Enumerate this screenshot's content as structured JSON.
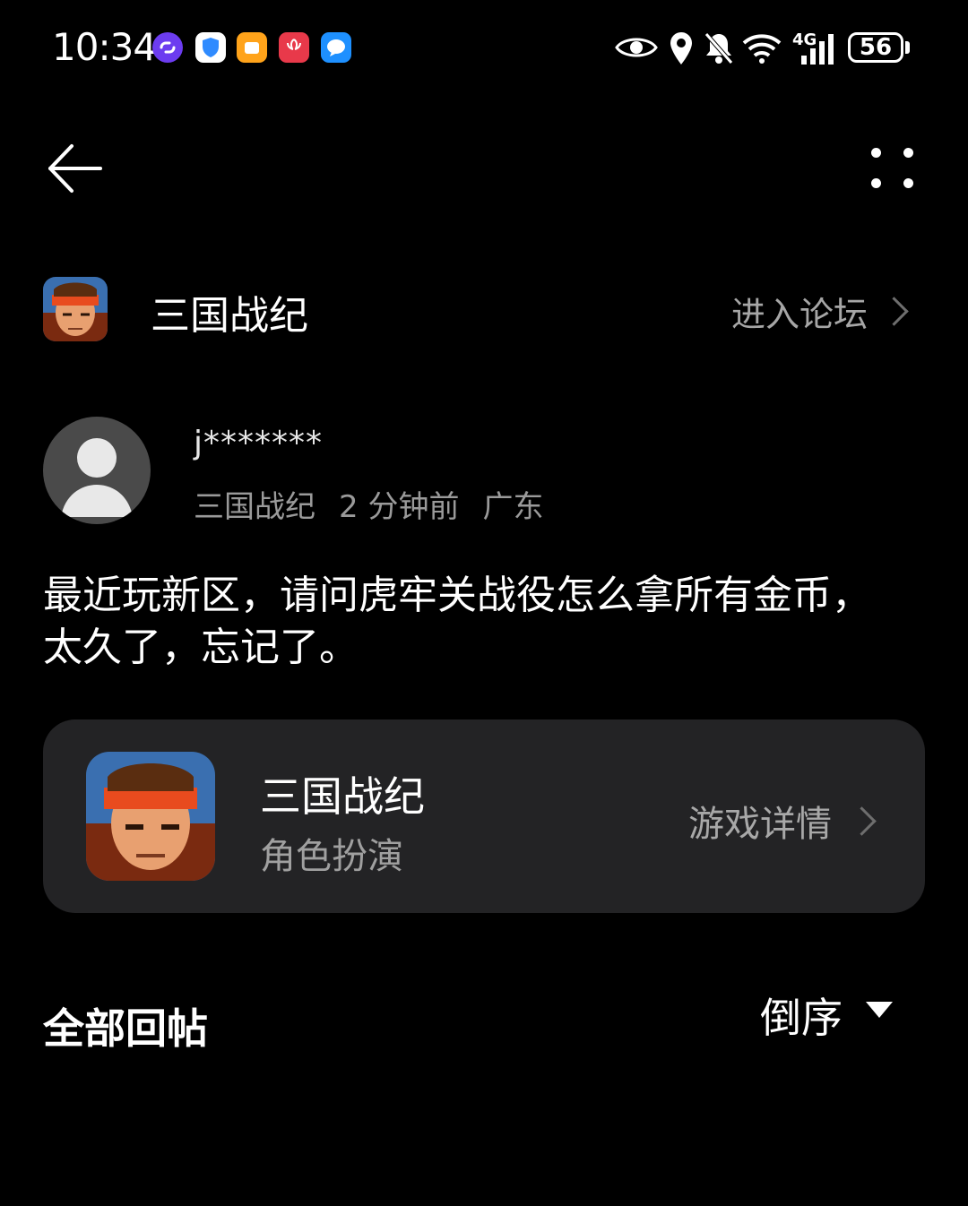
{
  "status_bar": {
    "time": "10:34",
    "network": "4G",
    "battery": "56",
    "app_icons": [
      {
        "name": "link-app-icon",
        "color": "#7b4dff"
      },
      {
        "name": "shield-app-icon",
        "color": "#2f8bff"
      },
      {
        "name": "orange-app-icon",
        "color": "#ffa31a"
      },
      {
        "name": "huawei-app-icon",
        "color": "#e8394a"
      },
      {
        "name": "message-app-icon",
        "color": "#1e90ff"
      }
    ]
  },
  "header": {
    "back_icon": "arrow-left-icon",
    "more_icon": "more-dots-icon"
  },
  "forum": {
    "name": "三国战纪",
    "enter_label": "进入论坛"
  },
  "post": {
    "author": "j*******",
    "meta": {
      "game": "三国战纪",
      "time": "2 分钟前",
      "location": "广东"
    },
    "body": "最近玩新区，请问虎牢关战役怎么拿所有金币，太久了，忘记了。"
  },
  "game_card": {
    "title": "三国战纪",
    "genre": "角色扮演",
    "detail_label": "游戏详情"
  },
  "replies": {
    "title": "全部回帖",
    "sort_label": "倒序"
  },
  "colors": {
    "background": "#000000",
    "card": "#232325",
    "secondary_text": "#9a9a9a"
  }
}
